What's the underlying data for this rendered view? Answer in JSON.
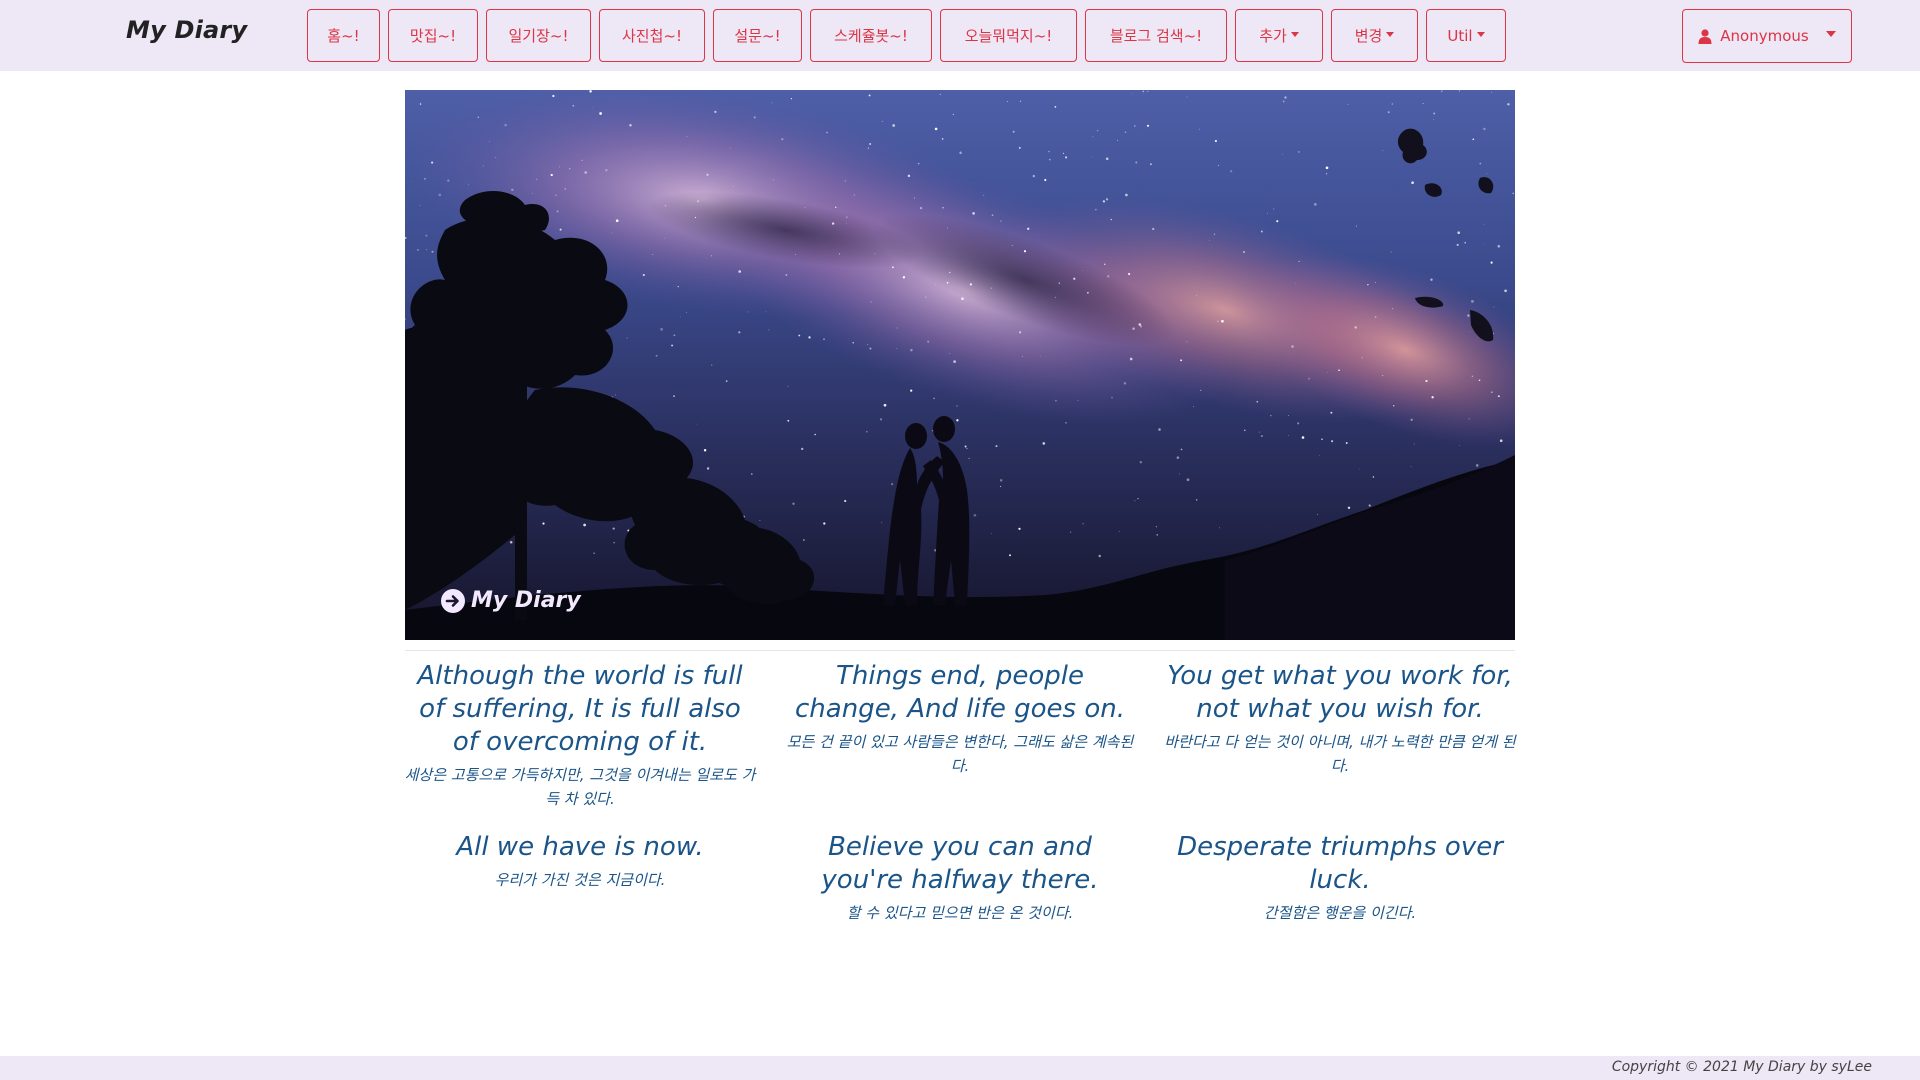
{
  "brand": "My Diary",
  "nav": {
    "items": [
      {
        "label": "홈~!",
        "dropdown": false
      },
      {
        "label": "맛집~!",
        "dropdown": false
      },
      {
        "label": "일기장~!",
        "dropdown": false
      },
      {
        "label": "사진첩~!",
        "dropdown": false
      },
      {
        "label": "설문~!",
        "dropdown": false
      },
      {
        "label": "스케쥴봇~!",
        "dropdown": false
      },
      {
        "label": "오늘뭐먹지~!",
        "dropdown": false
      },
      {
        "label": "블로그 검색~!",
        "dropdown": false
      },
      {
        "label": "추가",
        "dropdown": true
      },
      {
        "label": "변경",
        "dropdown": true
      },
      {
        "label": "Util",
        "dropdown": true
      }
    ],
    "user": {
      "label": "Anonymous",
      "icon": "user-icon"
    }
  },
  "hero": {
    "caption": "My Diary",
    "caption_icon": "arrow-circle-right-icon"
  },
  "quotes": [
    {
      "en": "Although the world is full of suffering, It is full also of overcoming of it.",
      "ko": "세상은 고통으로 가득하지만, 그것을 이겨내는 일로도 가득 차 있다."
    },
    {
      "en": "Things end, people change, And life goes on.",
      "ko": "모든 건 끝이 있고 사람들은 변한다, 그래도 삶은 계속된다."
    },
    {
      "en": "You get what you work for, not what you wish for.",
      "ko": "바란다고 다 얻는 것이 아니며, 내가 노력한 만큼 얻게 된다."
    },
    {
      "en": "All we have is now.",
      "ko": "우리가 가진 것은 지금이다."
    },
    {
      "en": "Believe you can and you're halfway there.",
      "ko": "할 수 있다고 믿으면 반은 온 것이다."
    },
    {
      "en": "Desperate triumphs over luck.",
      "ko": "간절함은 행운을 이긴다."
    }
  ],
  "footer": {
    "text": "Copyright © 2021 My Diary by syLee"
  },
  "colors": {
    "accent": "#dc3545",
    "navbar_bg": "#ede7f6",
    "quote_text": "#1a5488"
  }
}
